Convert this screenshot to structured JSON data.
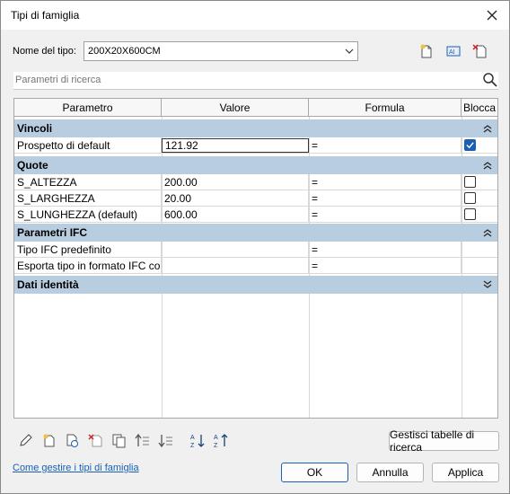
{
  "window": {
    "title": "Tipi di famiglia"
  },
  "type_selector": {
    "label": "Nome del tipo:",
    "value": "200X20X600CM"
  },
  "search": {
    "placeholder": "Parametri di ricerca"
  },
  "columns": [
    "Parametro",
    "Valore",
    "Formula",
    "Blocca"
  ],
  "groups": [
    {
      "name": "Vincoli",
      "rows": [
        {
          "param": "Prospetto di default",
          "value": "121.92",
          "formula": "=",
          "locked": true
        }
      ]
    },
    {
      "name": "Quote",
      "rows": [
        {
          "param": "S_ALTEZZA",
          "value": "200.00",
          "formula": "=",
          "locked": false
        },
        {
          "param": "S_LARGHEZZA",
          "value": "20.00",
          "formula": "=",
          "locked": false
        },
        {
          "param": "S_LUNGHEZZA (default)",
          "value": "600.00",
          "formula": "=",
          "locked": false
        }
      ]
    },
    {
      "name": "Parametri IFC",
      "rows": [
        {
          "param": "Tipo IFC predefinito",
          "value": "",
          "formula": "="
        },
        {
          "param": "Esporta tipo in formato IFC co",
          "value": "",
          "formula": "="
        }
      ]
    },
    {
      "name": "Dati identità",
      "rows": []
    }
  ],
  "buttons": {
    "manage_lookup": "Gestisci tabelle di ricerca",
    "ok": "OK",
    "cancel": "Annulla",
    "apply": "Applica"
  },
  "help_link": "Come gestire i tipi di famiglia",
  "colors": {
    "group_header": "#b8cde0",
    "accent": "#1a5fb4"
  }
}
